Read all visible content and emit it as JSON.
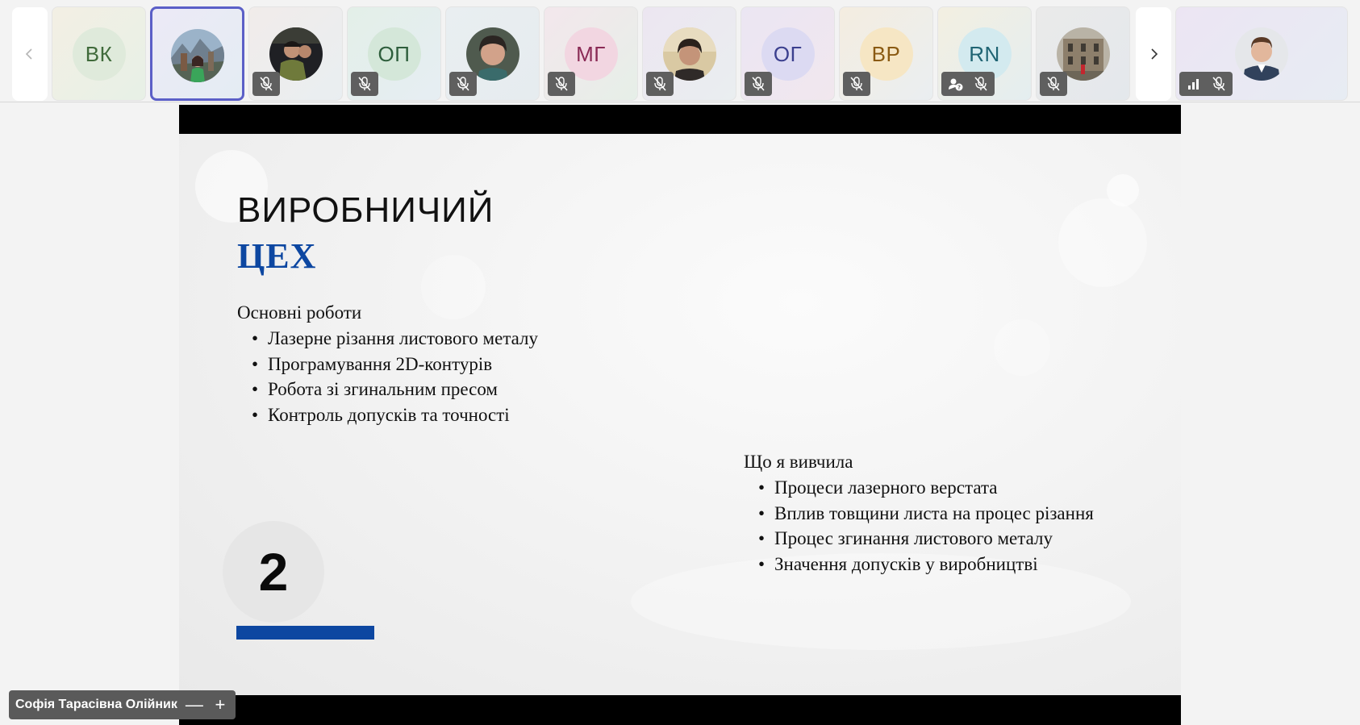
{
  "participants": [
    {
      "initials": "ВК",
      "bg": "#dfeadb",
      "fg": "#3f6a3a",
      "muted": false,
      "active": false
    },
    {
      "initials": "",
      "photo": "mountains-woman",
      "muted": false,
      "active": true
    },
    {
      "initials": "",
      "photo": "man-dark",
      "muted": true,
      "active": false
    },
    {
      "initials": "ОП",
      "bg": "#d4e7d9",
      "fg": "#2e5e3c",
      "muted": true,
      "active": false
    },
    {
      "initials": "",
      "photo": "woman-short-hair",
      "muted": true,
      "active": false
    },
    {
      "initials": "МГ",
      "bg": "#f2d6e1",
      "fg": "#8a2a55",
      "muted": true,
      "active": false
    },
    {
      "initials": "",
      "photo": "woman-call",
      "muted": true,
      "active": false
    },
    {
      "initials": "ОГ",
      "bg": "#dcdaf2",
      "fg": "#3b3f8e",
      "muted": true,
      "active": false
    },
    {
      "initials": "ВР",
      "bg": "#f6e6c4",
      "fg": "#8a5a12",
      "muted": true,
      "active": false
    },
    {
      "initials": "RN",
      "bg": "#d3eaef",
      "fg": "#1f6473",
      "muted": true,
      "active": false
    },
    {
      "initials": "",
      "photo": "building",
      "muted": true,
      "active": false
    },
    {
      "initials": "",
      "photo": "man-suit",
      "muted": true,
      "active": false,
      "signal": true
    }
  ],
  "slide": {
    "title_line1": "ВИРОБНИЧИЙ",
    "title_line2": "ЦЕХ",
    "left_section": {
      "heading": "Основні роботи",
      "items": [
        "Лазерне різання листового металу",
        "Програмування 2D-контурів",
        "Робота зі згинальним пресом",
        "Контроль допусків та точності"
      ]
    },
    "right_section": {
      "heading": "Що я вивчила",
      "items": [
        "Процеси лазерного верстата",
        "Вплив товщини листа на процес різання",
        "Процес згинання листового металу",
        "Значення допусків у виробництві"
      ]
    },
    "slide_number": "2",
    "accent_color": "#0d47a1"
  },
  "presenter": {
    "name": "Софія Тарасівна Олійник",
    "minimize_label": "—",
    "expand_label": "+"
  },
  "icons": {
    "prev": "chevron-left-icon",
    "next": "chevron-right-icon",
    "mute": "mic-off-icon",
    "raise": "raise-hand-icon",
    "signal": "signal-bars-icon"
  }
}
